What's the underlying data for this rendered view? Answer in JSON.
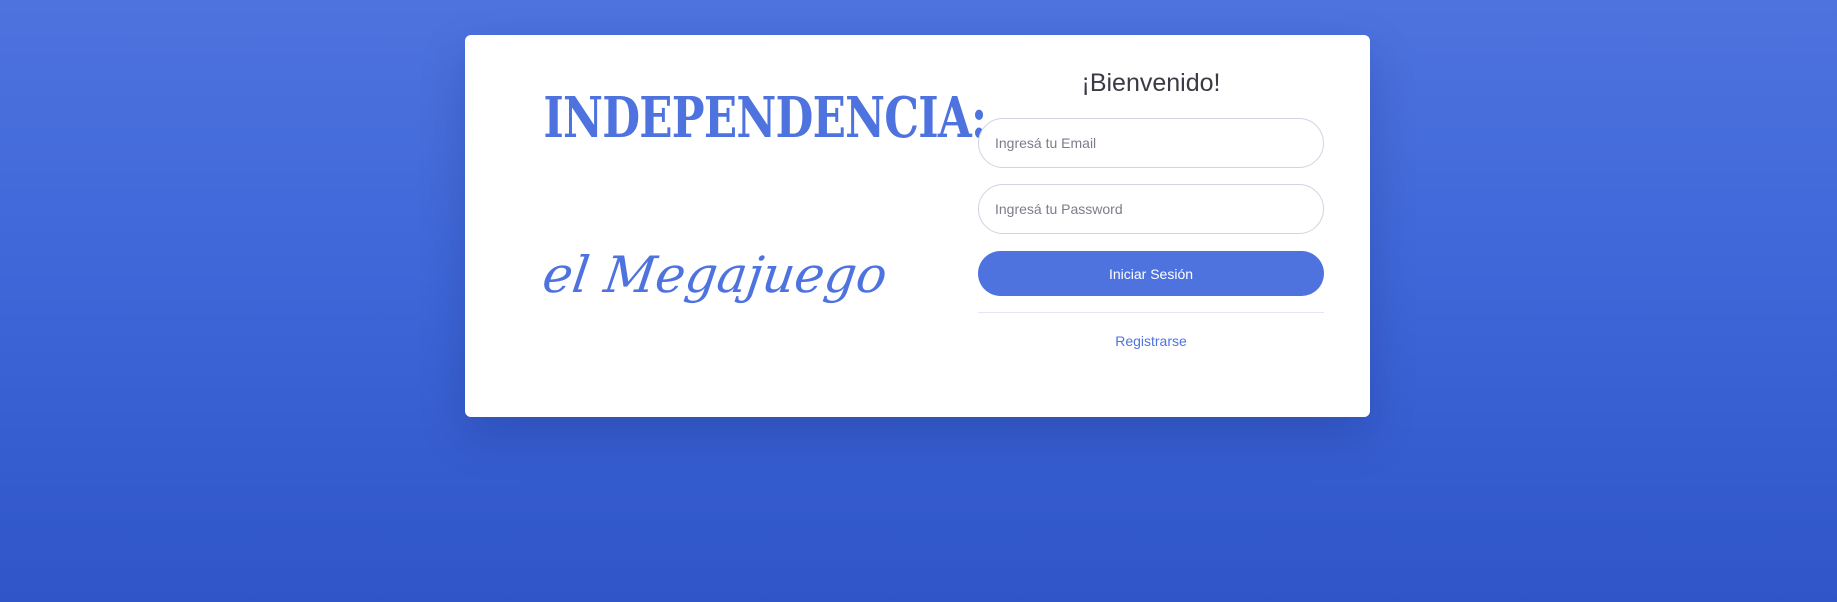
{
  "brand": {
    "title": "INDEPENDENCIA:",
    "subtitle": "el Megajuego"
  },
  "login": {
    "title": "¡Bienvenido!",
    "email_placeholder": "Ingresá tu Email",
    "password_placeholder": "Ingresá tu Password",
    "submit_label": "Iniciar Sesión",
    "register_label": "Registrarse"
  },
  "colors": {
    "accent": "#4e73df",
    "background_top": "#4e73df",
    "background_bottom": "#2f55c9",
    "card": "#ffffff"
  }
}
